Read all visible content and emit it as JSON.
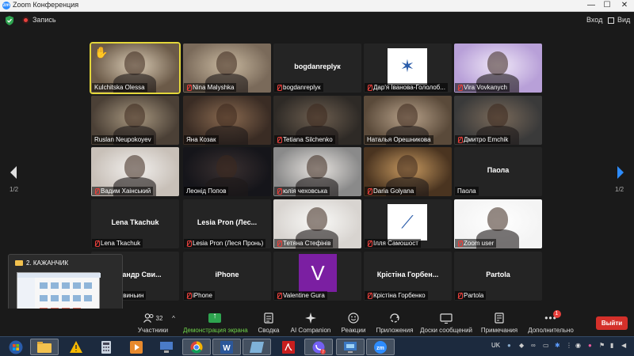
{
  "window": {
    "title": "Zoom Конференция",
    "minimize": "—",
    "maximize": "☐",
    "close": "✕"
  },
  "topbar": {
    "recording_label": "Запись",
    "enter_label": "Вход",
    "view_label": "Вид"
  },
  "pagination": {
    "left": "1/2",
    "right": "1/2"
  },
  "participants": [
    {
      "name": "Kulchitska Olessa",
      "muted": false,
      "video": "photo",
      "hand": true,
      "active": true
    },
    {
      "name": "Nina Malyshka",
      "muted": true,
      "video": "photo"
    },
    {
      "name": "bogdanreplук",
      "muted": true,
      "video": "none"
    },
    {
      "name": "Дар'я Іванова-Гололоб...",
      "muted": true,
      "video": "logo"
    },
    {
      "name": "Vira Vovkanych",
      "muted": true,
      "video": "photo"
    },
    {
      "name": "Ruslan Neupokoyev",
      "muted": false,
      "video": "photo"
    },
    {
      "name": "Яна Козак",
      "muted": false,
      "video": "photo"
    },
    {
      "name": "Tetiana Silchenko",
      "muted": true,
      "video": "photo"
    },
    {
      "name": "Наталья Орешникова",
      "muted": false,
      "video": "photo"
    },
    {
      "name": "Дмитро Emchik",
      "muted": true,
      "video": "photo"
    },
    {
      "name": "Вадим Хаінський",
      "muted": true,
      "video": "photo"
    },
    {
      "name": "Леонід Попов",
      "muted": false,
      "video": "photo"
    },
    {
      "name": "юлія чеховська",
      "muted": true,
      "video": "photo"
    },
    {
      "name": "Daria Golyana",
      "muted": true,
      "video": "photo"
    },
    {
      "name": "Паола",
      "muted": false,
      "video": "none",
      "center": "Паола"
    },
    {
      "name": "Lena Tkachuk",
      "muted": true,
      "video": "none",
      "center": "Lena Tkachuk"
    },
    {
      "name": "Lesia Pron (Леся Пронь)",
      "muted": true,
      "video": "none",
      "center": "Lesia Pron (Лес..."
    },
    {
      "name": "Тетяна Стефінів",
      "muted": true,
      "video": "photo"
    },
    {
      "name": "Ілля Самошост",
      "muted": true,
      "video": "logo"
    },
    {
      "name": "Zoom user",
      "muted": true,
      "video": "photo"
    },
    {
      "name": "...ндр Свиньин",
      "muted": true,
      "video": "none",
      "center": "...ксандр Сви..."
    },
    {
      "name": "iPhone",
      "muted": true,
      "video": "none",
      "center": "iPhone"
    },
    {
      "name": "Valentine Gura",
      "muted": true,
      "video": "avatar",
      "avatar_letter": "V"
    },
    {
      "name": "Крістіна Горбенко",
      "muted": true,
      "video": "none",
      "center": "Крістіна Горбен..."
    },
    {
      "name": "Partola",
      "muted": true,
      "video": "none",
      "center": "Partola"
    }
  ],
  "share_preview": {
    "title": "2. КАЖАНЧИК"
  },
  "toolbar": {
    "participants_count": "32",
    "participants_label": "Участники",
    "share_label": "Демонстрация экрана",
    "summary_label": "Сводка",
    "ai_label": "AI Companion",
    "reactions_label": "Реакции",
    "apps_label": "Приложения",
    "whiteboard_label": "Доски сообщений",
    "notes_label": "Примечания",
    "more_label": "Дополнительно",
    "more_badge": "1",
    "leave_label": "Выйти"
  },
  "taskbar": {
    "lang": "UK",
    "zoom_label": "zm",
    "viber_badge": "7"
  },
  "colors": {
    "accent_green": "#6fd34a",
    "leave_red": "#d4302a",
    "active_border": "#e3d63a",
    "zoom_blue": "#2d8cff"
  }
}
